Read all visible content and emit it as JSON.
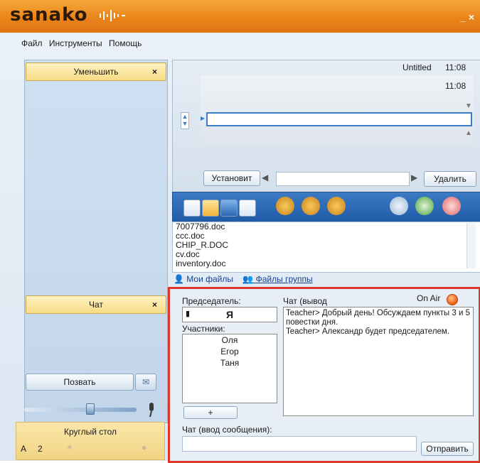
{
  "app": {
    "logo": "sanako",
    "minimize": "_",
    "close": "×"
  },
  "menu": [
    "Файл",
    "Инструменты",
    "Помощь"
  ],
  "left": {
    "reduce_label": "Уменьшить",
    "chat_label": "Чат",
    "close_x": "×",
    "call_label": "Позвать",
    "round_table_label": "Круглый стол",
    "round_table_letter": "A",
    "round_table_count": "2",
    "volume_level": 0.58
  },
  "player": {
    "title": "Untitled",
    "time_top": "11:08",
    "time_inner": "11:08",
    "set_label": "Установит",
    "delete_label": "Удалить"
  },
  "files": {
    "items": [
      "7007796.doc",
      "ccc.doc",
      "CHIP_R.DOC",
      "cv.doc",
      "inventory.doc"
    ],
    "tab_my": "Мои файлы",
    "tab_group": "Файлы группы"
  },
  "chat": {
    "chair_label": "Председатель:",
    "chair_value": "Я",
    "participants_label": "Участники:",
    "participants": [
      "Оля",
      "Егор",
      "Таня"
    ],
    "add_label": "+",
    "output_label": "Чат (вывод",
    "on_air": "On Air",
    "messages": [
      "Teacher> Добрый день! Обсуждаем пункты 3 и 5 повестки дня.",
      "Teacher> Александр будет председателем."
    ],
    "input_label": "Чат (ввод сообщения):",
    "send_label": "Отправить",
    "on_air_color": "#f05a12",
    "highlight_color": "#e0352b"
  }
}
